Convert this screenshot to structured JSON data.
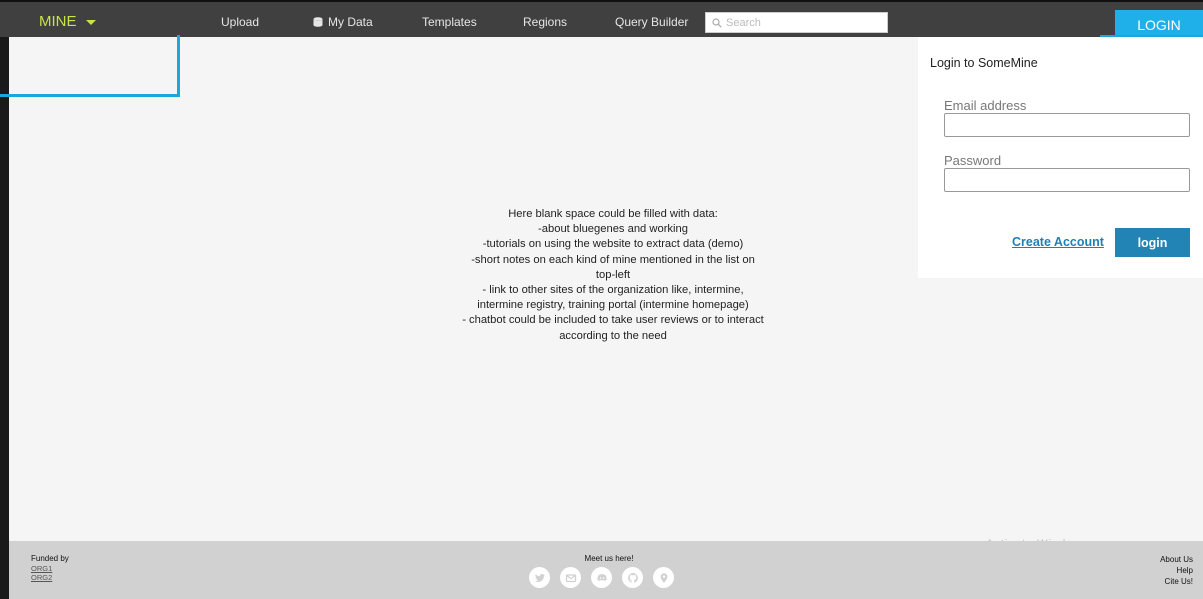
{
  "nav": {
    "brand": "MINE",
    "items": [
      {
        "label": "Upload"
      },
      {
        "label": "My Data"
      },
      {
        "label": "Templates"
      },
      {
        "label": "Regions"
      },
      {
        "label": "Query Builder"
      }
    ],
    "search_placeholder": "Search",
    "login_label": "LOGIN"
  },
  "login_panel": {
    "title": "Login to SomeMine",
    "email_label": "Email address",
    "password_label": "Password",
    "create_account": "Create Account",
    "login_button": "login"
  },
  "blank_note": {
    "lines": [
      "Here blank space could be filled with data:",
      "-about bluegenes and working",
      "-tutorials on using the website to extract data (demo)",
      "-short notes on each kind of mine mentioned in the list on",
      "top-left",
      "- link to other sites of the organization like, intermine,",
      "intermine registry, training portal (intermine homepage)",
      "- chatbot could be included to take user reviews or to interact",
      "according to the need"
    ]
  },
  "watermark": "Activate Wind",
  "footer": {
    "funded_by": "Funded by",
    "orgs": [
      "ORG1",
      "ORG2"
    ],
    "meet_us": "Meet us here!",
    "social_icons": [
      "twitter-icon",
      "mail-icon",
      "discord-icon",
      "github-icon",
      "location-icon"
    ],
    "links": [
      "About Us",
      "Help",
      "Cite Us!"
    ]
  },
  "colors": {
    "navbar": "#404040",
    "brand": "#c7e34a",
    "accent": "#1fb0ea",
    "login_button": "#2184b4",
    "footer": "#d1d1d1",
    "main_bg": "#f5f5f5"
  }
}
